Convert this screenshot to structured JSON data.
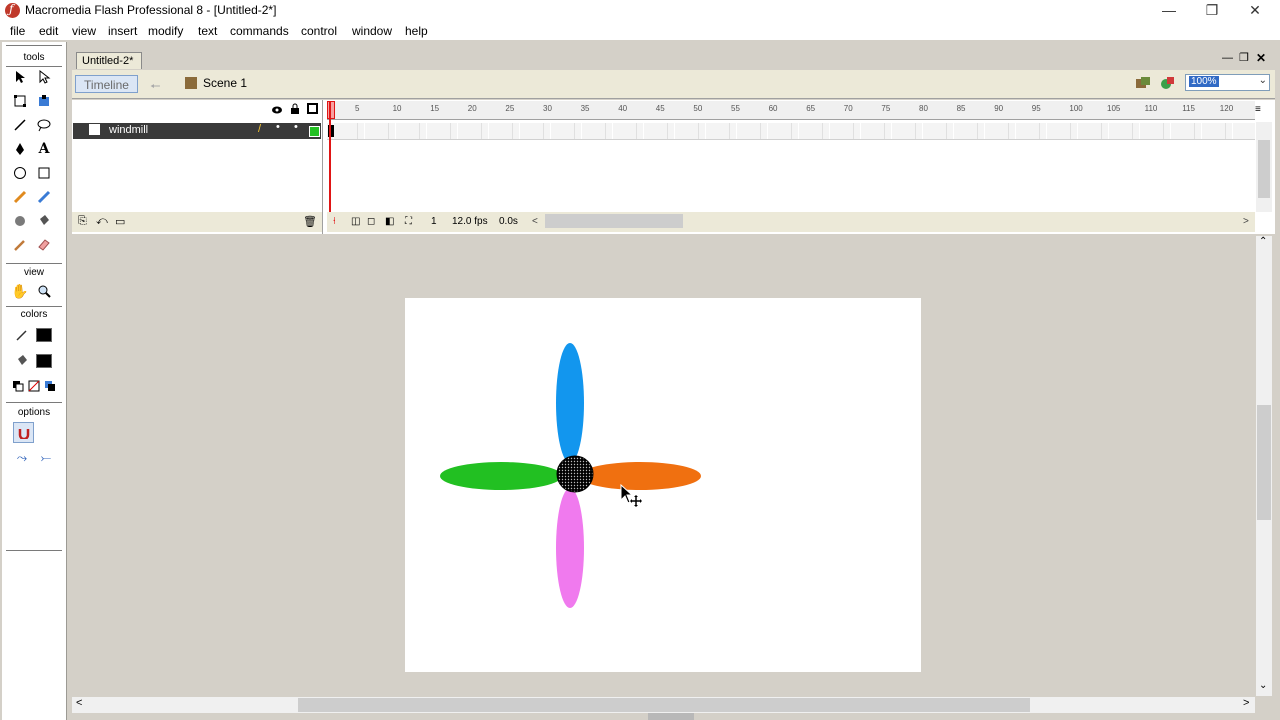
{
  "window": {
    "title": "Macromedia Flash Professional 8 - [Untitled-2*]"
  },
  "menu": [
    "file",
    "edit",
    "view",
    "insert",
    "modify",
    "text",
    "commands",
    "control",
    "window",
    "help"
  ],
  "tools_panel": {
    "tools_label": "tools",
    "view_label": "view",
    "colors_label": "colors",
    "options_label": "options"
  },
  "document": {
    "tab": "Untitled-2*",
    "timeline_button": "Timeline",
    "scene": "Scene 1",
    "zoom": "100%"
  },
  "timeline": {
    "layer_name": "windmill",
    "ruler_ticks": [
      "5",
      "10",
      "15",
      "20",
      "25",
      "30",
      "35",
      "40",
      "45",
      "50",
      "55",
      "60",
      "65",
      "70",
      "75",
      "80",
      "85",
      "90",
      "95",
      "100",
      "105",
      "110",
      "115",
      "120"
    ],
    "current_frame": "1",
    "fps": "12.0 fps",
    "time": "0.0s"
  },
  "stage": {
    "windmill_colors": {
      "top": "#1296ee",
      "right": "#f07010",
      "bottom": "#f07aee",
      "left": "#22c022",
      "hub": "#000000"
    }
  }
}
